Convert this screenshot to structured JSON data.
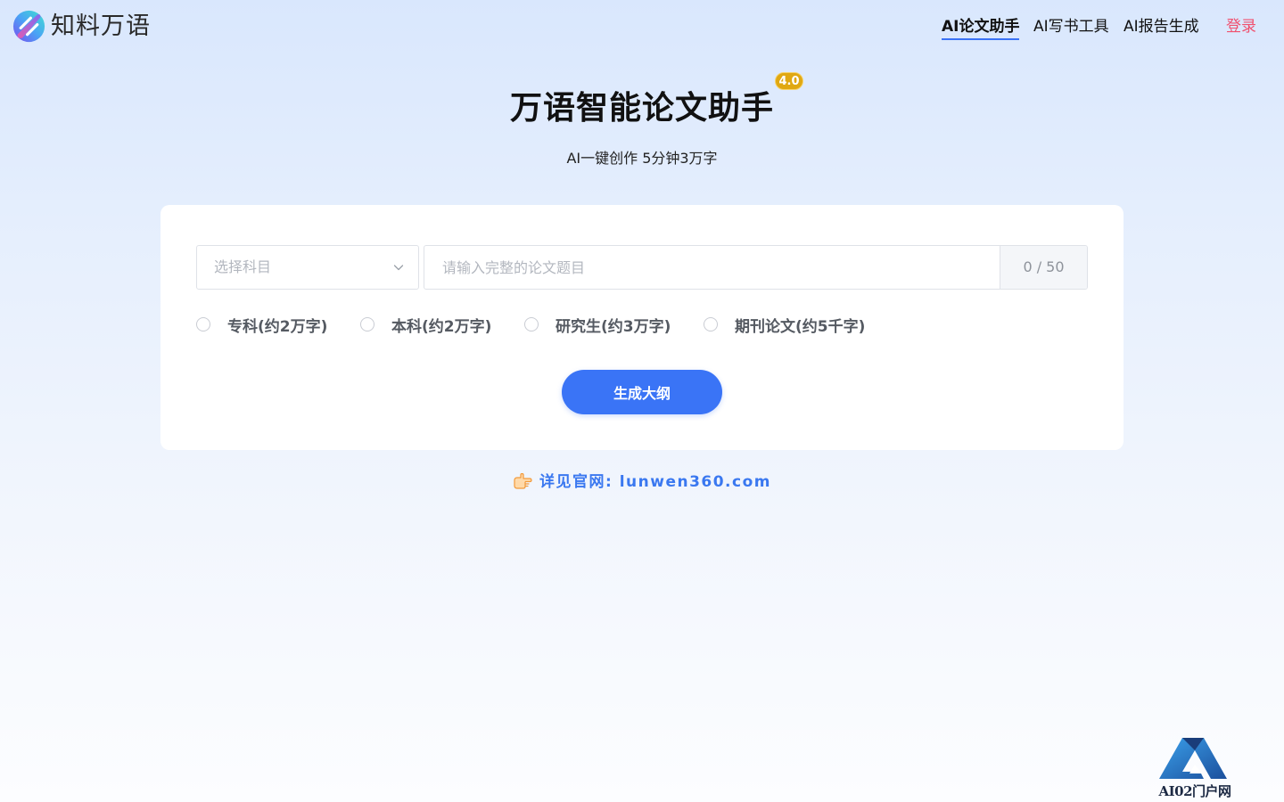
{
  "header": {
    "brand": "知料万语",
    "nav": [
      {
        "label": "AI论文助手",
        "active": true
      },
      {
        "label": "AI写书工具",
        "active": false
      },
      {
        "label": "AI报告生成",
        "active": false
      }
    ],
    "login_label": "登录"
  },
  "hero": {
    "title": "万语智能论文助手",
    "version_badge": "4.0",
    "subtitle": "AI一键创作 5分钟3万字"
  },
  "form": {
    "subject_placeholder": "选择科目",
    "title_placeholder": "请输入完整的论文题目",
    "title_value": "",
    "char_count": "0 / 50",
    "paper_types": [
      {
        "label": "专科(约2万字)",
        "selected": false
      },
      {
        "label": "本科(约2万字)",
        "selected": false
      },
      {
        "label": "研究生(约3万字)",
        "selected": false
      },
      {
        "label": "期刊论文(约5千字)",
        "selected": false
      }
    ],
    "generate_label": "生成大纲"
  },
  "footer": {
    "link_text": "详见官网: lunwen360.com"
  },
  "watermark": {
    "text": "AI02门户网"
  },
  "colors": {
    "accent": "#3a74f6",
    "login": "#f0506e",
    "badge": "#e0a812",
    "link": "#3a78f0"
  },
  "icons": {
    "logo": "brand-logo-icon",
    "subject_dropdown": "chevron-down-icon",
    "footer_pointer": "pointing-hand-icon",
    "watermark": "a-mountain-logo-icon"
  }
}
